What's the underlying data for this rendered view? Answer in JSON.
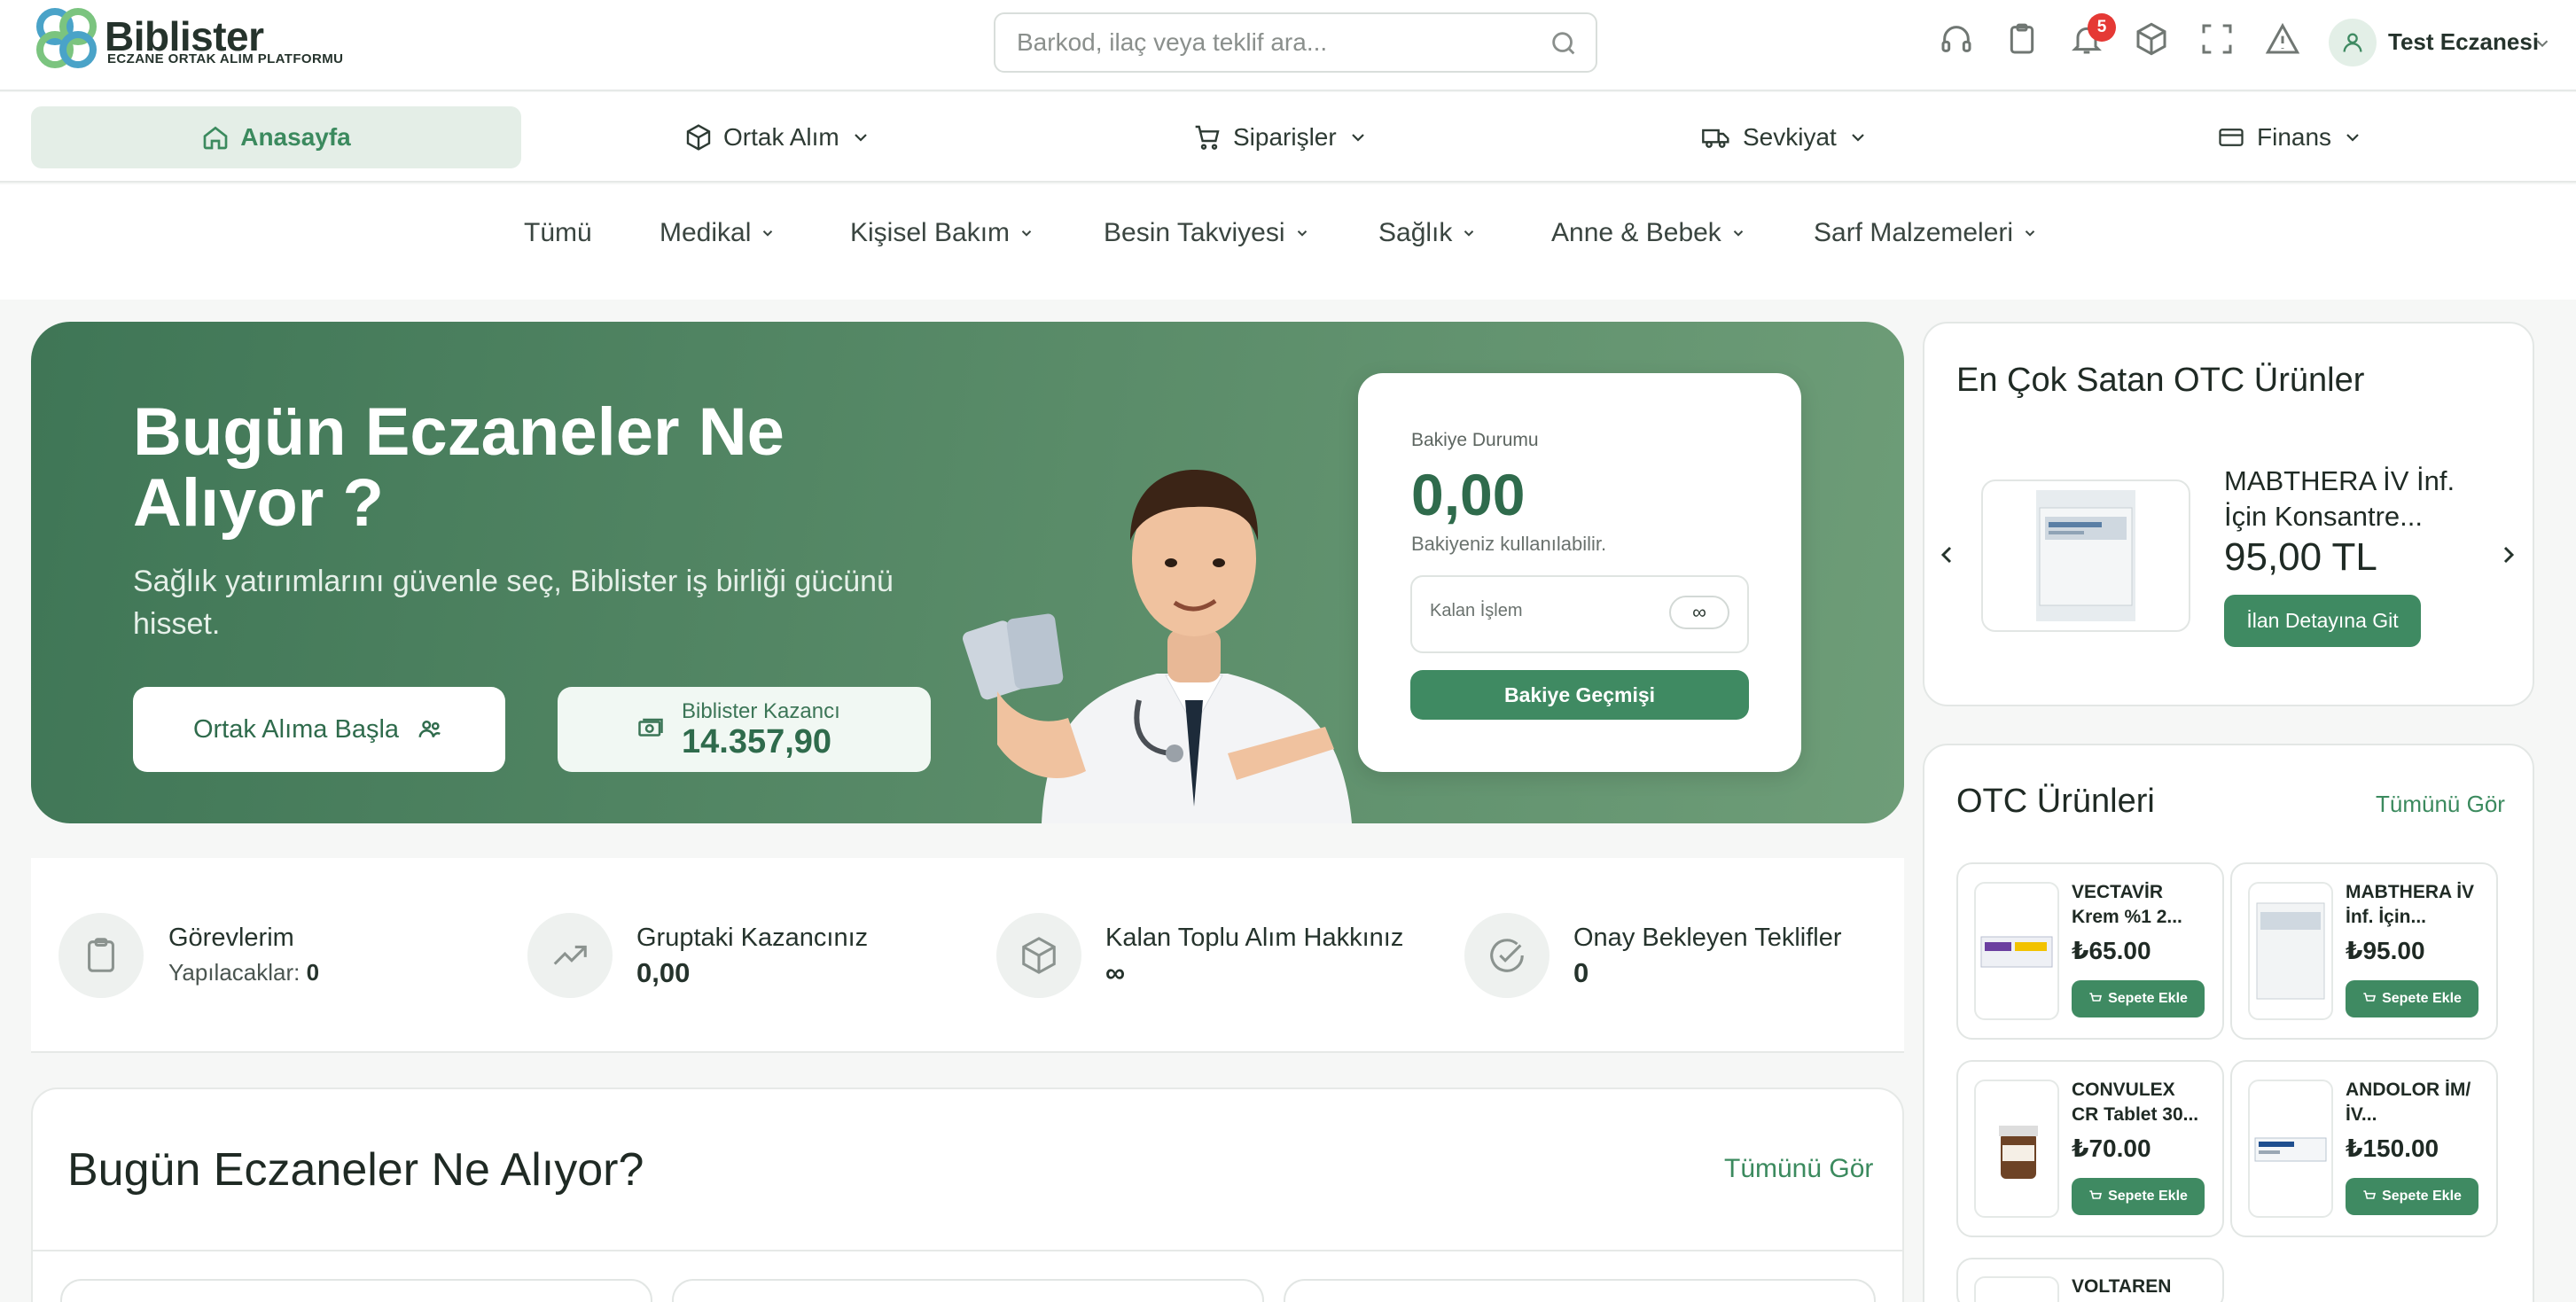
{
  "brand": {
    "name": "Biblister",
    "tagline": "ECZANE ORTAK ALIM PLATFORMU"
  },
  "search": {
    "placeholder": "Barkod, ilaç veya teklif ara..."
  },
  "header": {
    "notification_count": "5",
    "user_name": "Test Eczanesi"
  },
  "nav": {
    "home": "Anasayfa",
    "items": [
      {
        "label": "Ortak Alım"
      },
      {
        "label": "Siparişler"
      },
      {
        "label": "Sevkiyat"
      },
      {
        "label": "Finans"
      }
    ]
  },
  "categories": [
    "Tümü",
    "Medikal",
    "Kişisel Bakım",
    "Besin Takviyesi",
    "Sağlık",
    "Anne & Bebek",
    "Sarf Malzemeleri"
  ],
  "hero": {
    "title": "Bugün Eczaneler Ne Alıyor ?",
    "subtitle": "Sağlık yatırımlarını güvenle seç, Biblister iş birliği gücünü hisset.",
    "start_button": "Ortak Alıma Başla",
    "gain_label": "Biblister Kazancı",
    "gain_value": "14.357,90"
  },
  "balance": {
    "label": "Bakiye Durumu",
    "value": "0,00",
    "note": "Bakiyeniz kullanılabilir.",
    "remaining_label": "Kalan İşlem",
    "remaining_value": "∞",
    "history_button": "Bakiye Geçmişi"
  },
  "stats": [
    {
      "title": "Görevlerim",
      "sub_label": "Yapılacaklar:",
      "value": "0"
    },
    {
      "title": "Gruptaki Kazancınız",
      "value": "0,00"
    },
    {
      "title": "Kalan Toplu Alım Hakkınız",
      "value": "∞"
    },
    {
      "title": "Onay Bekleyen Teklifler",
      "value": "0"
    }
  ],
  "today_section": {
    "title": "Bugün Eczaneler Ne Alıyor?",
    "see_all": "Tümünü Gör"
  },
  "best_sellers": {
    "title": "En Çok Satan OTC Ürünler",
    "product_name": "MABTHERA İV İnf. İçin Konsantre...",
    "product_price": "95,00 TL",
    "detail_button": "İlan Detayına Git"
  },
  "otc": {
    "title": "OTC Ürünleri",
    "see_all": "Tümünü Gör",
    "add_label": "Sepete Ekle",
    "products": [
      {
        "name": "VECTAVİR Krem %1 2...",
        "price": "₺65.00"
      },
      {
        "name": "MABTHERA İV İnf. İçin...",
        "price": "₺95.00"
      },
      {
        "name": "CONVULEX CR Tablet 30...",
        "price": "₺70.00"
      },
      {
        "name": "ANDOLOR İM/ İV...",
        "price": "₺150.00"
      },
      {
        "name": "VOLTAREN",
        "price": ""
      }
    ]
  },
  "colors": {
    "primary": "#3f8a62",
    "hero_start": "#3f7656",
    "hero_end": "#6e9d78",
    "badge": "#e53935"
  }
}
